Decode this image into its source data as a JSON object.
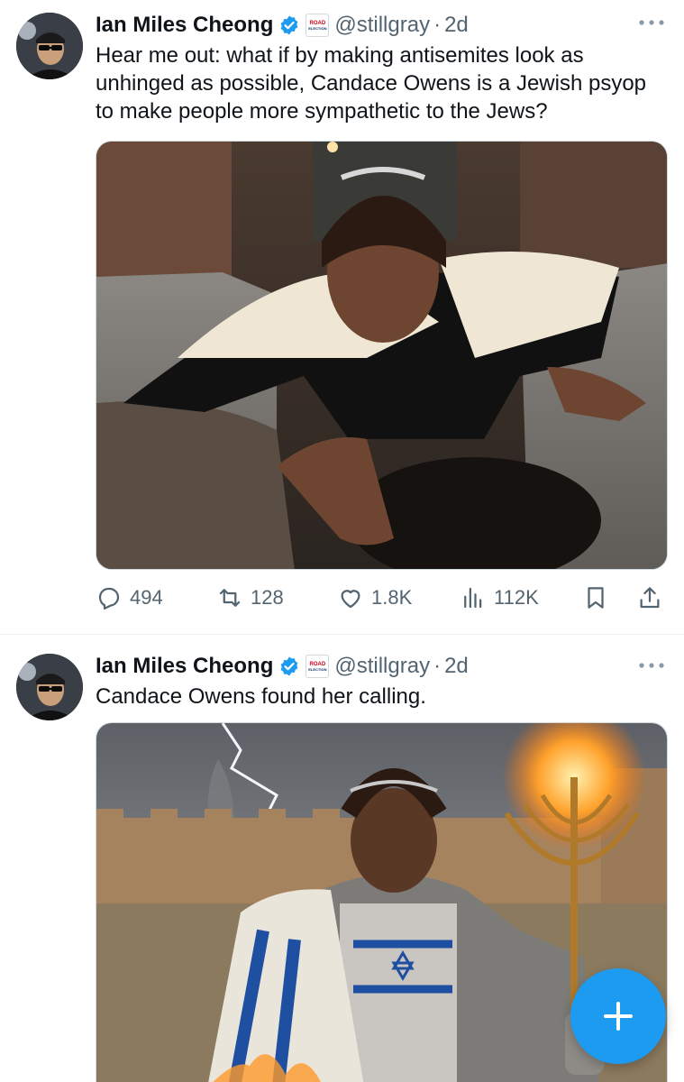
{
  "tweets": [
    {
      "author_name": "Ian Miles Cheong",
      "handle": "@stillgray",
      "separator": "·",
      "time": "2d",
      "affiliation_badge": {
        "line1": "ROAD",
        "line2": "ELECTION"
      },
      "text": "Hear me out: what if by making antisemites look as unhinged as possible, Candace Owens is a Jewish psyop to make people more sympathetic to the Jews?",
      "stats": {
        "replies": "494",
        "reposts": "128",
        "likes": "1.8K",
        "views": "112K"
      }
    },
    {
      "author_name": "Ian Miles Cheong",
      "handle": "@stillgray",
      "separator": "·",
      "time": "2d",
      "affiliation_badge": {
        "line1": "ROAD",
        "line2": "ELECTION"
      },
      "text": "Candace Owens found her calling."
    }
  ],
  "icons": {
    "verified": "verified-badge-icon",
    "more": "more-options-icon",
    "reply": "reply-icon",
    "retweet": "retweet-icon",
    "like": "heart-icon",
    "views": "views-chart-icon",
    "bookmark": "bookmark-icon",
    "share": "share-icon",
    "compose": "plus-icon"
  },
  "colors": {
    "accent": "#1d9bf0",
    "text_primary": "#0f1419",
    "text_secondary": "#536471",
    "border": "#cfd9de"
  }
}
